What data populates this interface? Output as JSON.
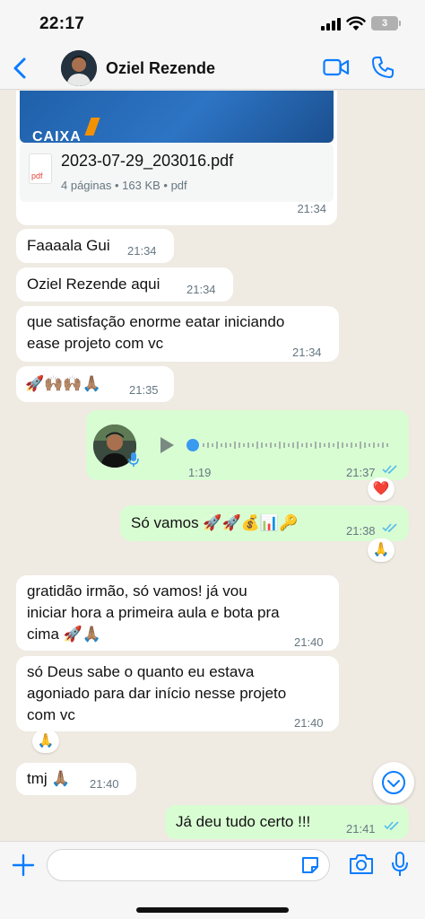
{
  "status_bar": {
    "time": "22:17",
    "battery": "3"
  },
  "header": {
    "contact_name": "Oziel Rezende"
  },
  "document_message": {
    "banner_text": "CAIXA",
    "file_name": "2023-07-29_203016.pdf",
    "file_meta": "4 páginas • 163 KB • pdf",
    "file_type": "pdf",
    "time": "21:34"
  },
  "messages": [
    {
      "text": "Faaaala Gui",
      "time": "21:34",
      "direction": "in"
    },
    {
      "text": "Oziel Rezende aqui",
      "time": "21:34",
      "direction": "in"
    },
    {
      "text_line1": "que satisfação enorme eatar iniciando",
      "text_line2": "ease projeto com vc",
      "time": "21:34",
      "direction": "in"
    },
    {
      "text": "🚀🙌🏽🙌🏽🙏🏽",
      "time": "21:35",
      "direction": "in"
    },
    {
      "text": "Só vamos 🚀🚀💰📊🔑",
      "time": "21:38",
      "direction": "out",
      "status": "read"
    },
    {
      "text_line1": "gratidão irmão, só vamos! já vou",
      "text_line2": "iniciar hora a primeira aula e bota pra",
      "text_line3": "cima 🚀🙏🏽",
      "time": "21:40",
      "direction": "in"
    },
    {
      "text_line1": "só Deus sabe o quanto eu estava",
      "text_line2": "agoniado para dar início nesse projeto",
      "text_line3": "com vc",
      "time": "21:40",
      "direction": "in"
    },
    {
      "text": "tmj 🙏🏽",
      "time": "21:40",
      "direction": "in"
    },
    {
      "text": "Já deu tudo certo !!!",
      "time": "21:41",
      "direction": "out",
      "status": "read"
    }
  ],
  "voice_message": {
    "duration": "1:19",
    "time": "21:37",
    "direction": "out",
    "status": "read"
  },
  "reactions": {
    "voice": "❤️",
    "so_vamos": "🙏",
    "agoniado": "🙏"
  },
  "input": {
    "placeholder": ""
  },
  "colors": {
    "incoming_bubble": "#ffffff",
    "outgoing_bubble": "#d9fdd3",
    "accent": "#0a7cff",
    "read_ticks": "#53bdeb",
    "background": "#efeae2"
  },
  "icons": [
    "back-arrow-icon",
    "video-camera-icon",
    "phone-icon",
    "pdf-icon",
    "play-icon",
    "mic-icon",
    "chevron-down-icon",
    "plus-icon",
    "sticker-icon",
    "camera-icon"
  ]
}
